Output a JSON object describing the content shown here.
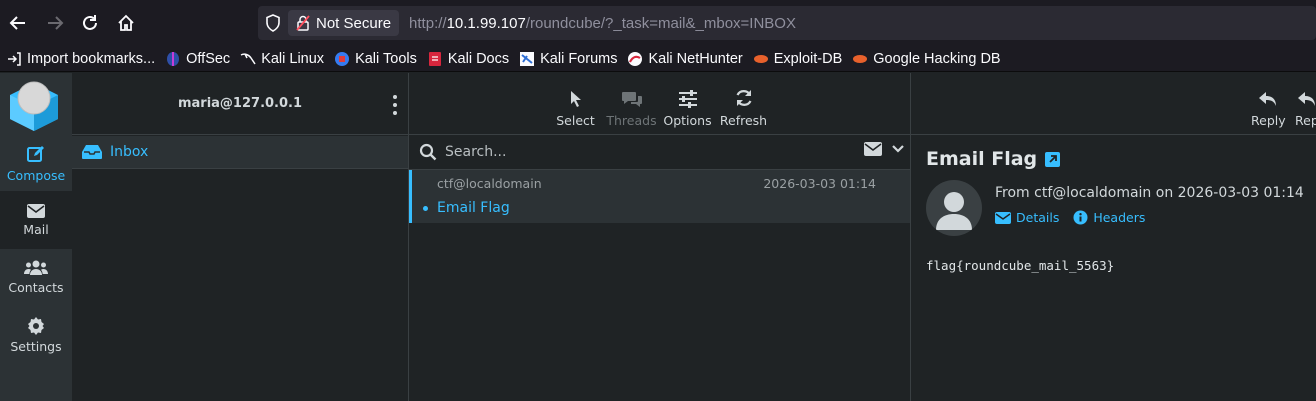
{
  "browser": {
    "security_label": "Not Secure",
    "url_prefix": "http://",
    "url_host": "10.1.99.107",
    "url_path": "/roundcube/?_task=mail&_mbox=INBOX",
    "bookmarks": [
      {
        "label": "Import bookmarks...",
        "icon": "import-icon"
      },
      {
        "label": "OffSec",
        "icon": "offsec-icon"
      },
      {
        "label": "Kali Linux",
        "icon": "kali-dragon-icon"
      },
      {
        "label": "Kali Tools",
        "icon": "kali-tools-icon"
      },
      {
        "label": "Kali Docs",
        "icon": "kali-docs-icon"
      },
      {
        "label": "Kali Forums",
        "icon": "kali-forums-icon"
      },
      {
        "label": "Kali NetHunter",
        "icon": "nethunter-icon"
      },
      {
        "label": "Exploit-DB",
        "icon": "exploitdb-icon"
      },
      {
        "label": "Google Hacking DB",
        "icon": "ghdb-icon"
      }
    ]
  },
  "nav": {
    "compose": "Compose",
    "mail": "Mail",
    "contacts": "Contacts",
    "settings": "Settings"
  },
  "folders": {
    "account": "maria@127.0.0.1",
    "inbox": "Inbox"
  },
  "toolbar": {
    "select": "Select",
    "threads": "Threads",
    "options": "Options",
    "refresh": "Refresh"
  },
  "search": {
    "placeholder": "Search..."
  },
  "message_list": [
    {
      "from": "ctf@localdomain",
      "date": "2026-03-03 01:14",
      "subject": "Email Flag"
    }
  ],
  "preview": {
    "reply": "Reply",
    "reply_all": "Repl",
    "title": "Email Flag",
    "from_line": "From ctf@localdomain on 2026-03-03 01:14",
    "details": "Details",
    "headers": "Headers",
    "body": "flag{roundcube_mail_5563}"
  },
  "colors": {
    "accent": "#37beff",
    "background": "#1f2325",
    "panel": "#2c3235"
  }
}
